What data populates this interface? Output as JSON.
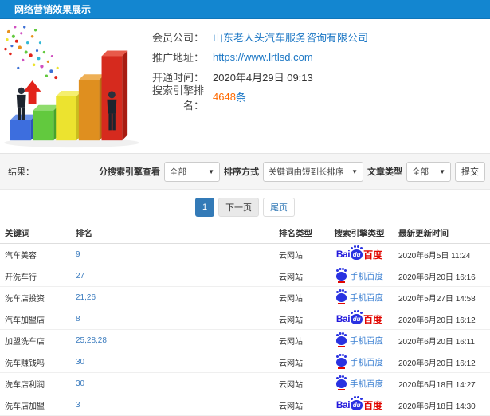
{
  "header": {
    "title": "网络营销效果展示"
  },
  "info": {
    "fields": [
      {
        "label": "会员公司：",
        "value": "山东老人头汽车服务咨询有限公司"
      },
      {
        "label": "推广地址：",
        "value": "https://www.lrtlsd.com"
      },
      {
        "label": "开通时间：",
        "value": "2020年4月29日 09:13"
      },
      {
        "label": "搜索引擎排名：",
        "value": "4648",
        "suffix": "条"
      }
    ]
  },
  "filters": {
    "result_label": "结果：",
    "engine_label": "分搜索引擎查看",
    "engine_value": "全部",
    "sort_label": "排序方式",
    "sort_value": "关键词由短到长排序",
    "type_label": "文章类型",
    "type_value": "全部",
    "submit_label": "提交",
    "caret": "▼"
  },
  "pagination": {
    "current": "1",
    "next": "下一页",
    "last": "尾页"
  },
  "table": {
    "headers": [
      "关键词",
      "排名",
      "排名类型",
      "搜索引擎类型",
      "最新更新时间"
    ],
    "engine_labels": {
      "baidu": {
        "bai": "Bai",
        "du": "du",
        "cn": "百度"
      },
      "mobile": {
        "text": "手机百度"
      }
    },
    "rows": [
      {
        "keyword": "汽车美容",
        "rank": "9",
        "rank_type": "云网站",
        "engine": "baidu",
        "time": "2020年6月5日 11:24"
      },
      {
        "keyword": "开洗车行",
        "rank": "27",
        "rank_type": "云网站",
        "engine": "mobile",
        "time": "2020年6月20日 16:16"
      },
      {
        "keyword": "洗车店投资",
        "rank": "21,26",
        "rank_type": "云网站",
        "engine": "mobile",
        "time": "2020年5月27日 14:58"
      },
      {
        "keyword": "汽车加盟店",
        "rank": "8",
        "rank_type": "云网站",
        "engine": "baidu",
        "time": "2020年6月20日 16:12"
      },
      {
        "keyword": "加盟洗车店",
        "rank": "25,28,28",
        "rank_type": "云网站",
        "engine": "mobile",
        "time": "2020年6月20日 16:11"
      },
      {
        "keyword": "洗车赚钱吗",
        "rank": "30",
        "rank_type": "云网站",
        "engine": "mobile",
        "time": "2020年6月20日 16:12"
      },
      {
        "keyword": "洗车店利润",
        "rank": "30",
        "rank_type": "云网站",
        "engine": "mobile",
        "time": "2020年6月18日 14:27"
      },
      {
        "keyword": "洗车店加盟",
        "rank": "3",
        "rank_type": "云网站",
        "engine": "baidu",
        "time": "2020年6月18日 14:30"
      }
    ]
  },
  "colors": {
    "topbar": "#1386d0",
    "link": "#1a76c4",
    "rank_link": "#3a7bbe",
    "highlight_orange": "#ff6a00",
    "baidu_blue": "#2319dc",
    "baidu_red": "#e10601",
    "pagination_active": "#337ab7"
  }
}
